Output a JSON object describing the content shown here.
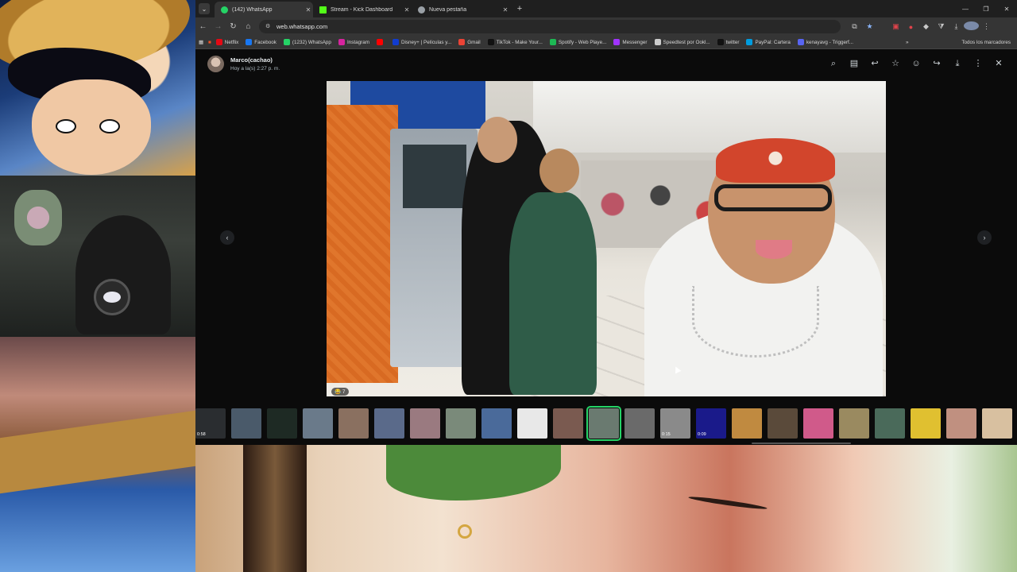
{
  "browser": {
    "tabs": [
      {
        "title": "(142) WhatsApp",
        "active": true,
        "favicon_color": "#25d366"
      },
      {
        "title": "Stream - Kick Dashboard",
        "active": false,
        "favicon_color": "#53fc18"
      },
      {
        "title": "Nueva pestaña",
        "active": false,
        "favicon_color": "#9aa0a6"
      }
    ],
    "url": "web.whatsapp.com",
    "bookmarks": [
      {
        "label": "Netflix",
        "color": "#e50914"
      },
      {
        "label": "Facebook",
        "color": "#1877f2"
      },
      {
        "label": "(1232) WhatsApp",
        "color": "#25d366"
      },
      {
        "label": "Instagram",
        "color": "#d6249f"
      },
      {
        "label": "",
        "color": "#ff0000"
      },
      {
        "label": "Disney+ | Películas y...",
        "color": "#113ccf"
      },
      {
        "label": "Gmail",
        "color": "#ea4335"
      },
      {
        "label": "TikTok - Make Your...",
        "color": "#111111"
      },
      {
        "label": "Spotify - Web Playe...",
        "color": "#1db954"
      },
      {
        "label": "Messenger",
        "color": "#a033ff"
      },
      {
        "label": "Speedtest por Ookl...",
        "color": "#cccccc"
      },
      {
        "label": "twitter",
        "color": "#111111"
      },
      {
        "label": "PayPal: Cartera",
        "color": "#009cde"
      },
      {
        "label": "kenayavg - Triggerf...",
        "color": "#5865f2"
      }
    ],
    "all_bookmarks_label": "Todos los marcadores"
  },
  "viewer": {
    "sender_name": "Marco(cachao)",
    "timestamp": "Hoy a la(s) 2:27 p. m.",
    "reaction": "😂 7",
    "accent_color": "#25d366",
    "thumbnails": [
      {
        "bg": "#2a2d30",
        "duration": "0:58"
      },
      {
        "bg": "#4a5a6a",
        "duration": ""
      },
      {
        "bg": "#1e2a24",
        "duration": ""
      },
      {
        "bg": "#6a7a8a",
        "duration": ""
      },
      {
        "bg": "#8a7060",
        "duration": ""
      },
      {
        "bg": "#5a6a8a",
        "duration": ""
      },
      {
        "bg": "#9a7a80",
        "duration": ""
      },
      {
        "bg": "#7a8a7a",
        "duration": ""
      },
      {
        "bg": "#4a6a9a",
        "duration": ""
      },
      {
        "bg": "#e8e8e8",
        "duration": ""
      },
      {
        "bg": "#7a5a50",
        "duration": ""
      },
      {
        "bg": "#6a7a70",
        "duration": "",
        "selected": true
      },
      {
        "bg": "#6a6a6a",
        "duration": ""
      },
      {
        "bg": "#8a8a8a",
        "duration": "0:15"
      },
      {
        "bg": "#1a1a8a",
        "duration": "0:09"
      },
      {
        "bg": "#c08a40",
        "duration": ""
      },
      {
        "bg": "#5a4a3a",
        "duration": ""
      },
      {
        "bg": "#d05a8a",
        "duration": ""
      },
      {
        "bg": "#9a8a60",
        "duration": ""
      },
      {
        "bg": "#4a6a5a",
        "duration": ""
      },
      {
        "bg": "#e0c030",
        "duration": ""
      },
      {
        "bg": "#c09080",
        "duration": ""
      },
      {
        "bg": "#d8c0a0",
        "duration": ""
      }
    ]
  }
}
